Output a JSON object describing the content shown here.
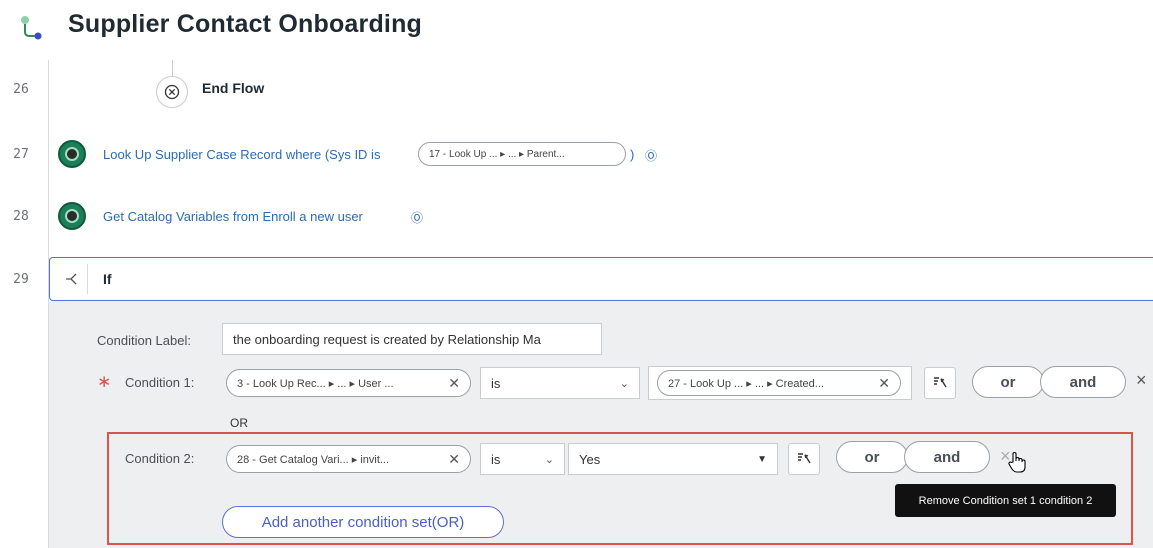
{
  "app": {
    "title": "Supplier Contact Onboarding",
    "logo_icon": "flow-branch-icon"
  },
  "rows": {
    "r26": {
      "num": "26",
      "label": "End Flow",
      "icon": "close-circle-icon"
    },
    "r27": {
      "num": "27",
      "text": "Look Up Supplier Case Record where (Sys ID is",
      "pill": "17 - Look Up ...  ▸ ...  ▸ Parent...",
      "close": ")",
      "help": "Ⓞ"
    },
    "r28": {
      "num": "28",
      "text": "Get Catalog Variables from Enroll a new user",
      "help": "Ⓞ"
    },
    "r29": {
      "num": "29",
      "label": "If",
      "icon": "if-branch-icon"
    }
  },
  "conditions": {
    "label_caption": "Condition Label:",
    "label_value": "the onboarding request is created by Relationship Ma",
    "required_mark": "∗",
    "c1": {
      "caption": "Condition 1:",
      "left_pill": "3 - Look Up Rec...  ▸ ...  ▸ User ...",
      "operator": "is",
      "right_pill": "27 - Look Up ...  ▸ ...  ▸ Created...",
      "or": "or",
      "and": "and",
      "remove": "×"
    },
    "or_separator": "OR",
    "c2": {
      "caption": "Condition 2:",
      "left_pill": "28 - Get Catalog Vari...  ▸ invit...",
      "operator": "is",
      "value": "Yes",
      "or": "or",
      "and": "and",
      "remove": "×"
    },
    "add_set": "Add another condition set(OR)",
    "tooltip": "Remove Condition set 1 condition 2"
  },
  "colors": {
    "accent": "#5b6fd6",
    "link": "#2a6bb8",
    "highlight": "#d9534f",
    "step_green": "#1c7f5a"
  }
}
